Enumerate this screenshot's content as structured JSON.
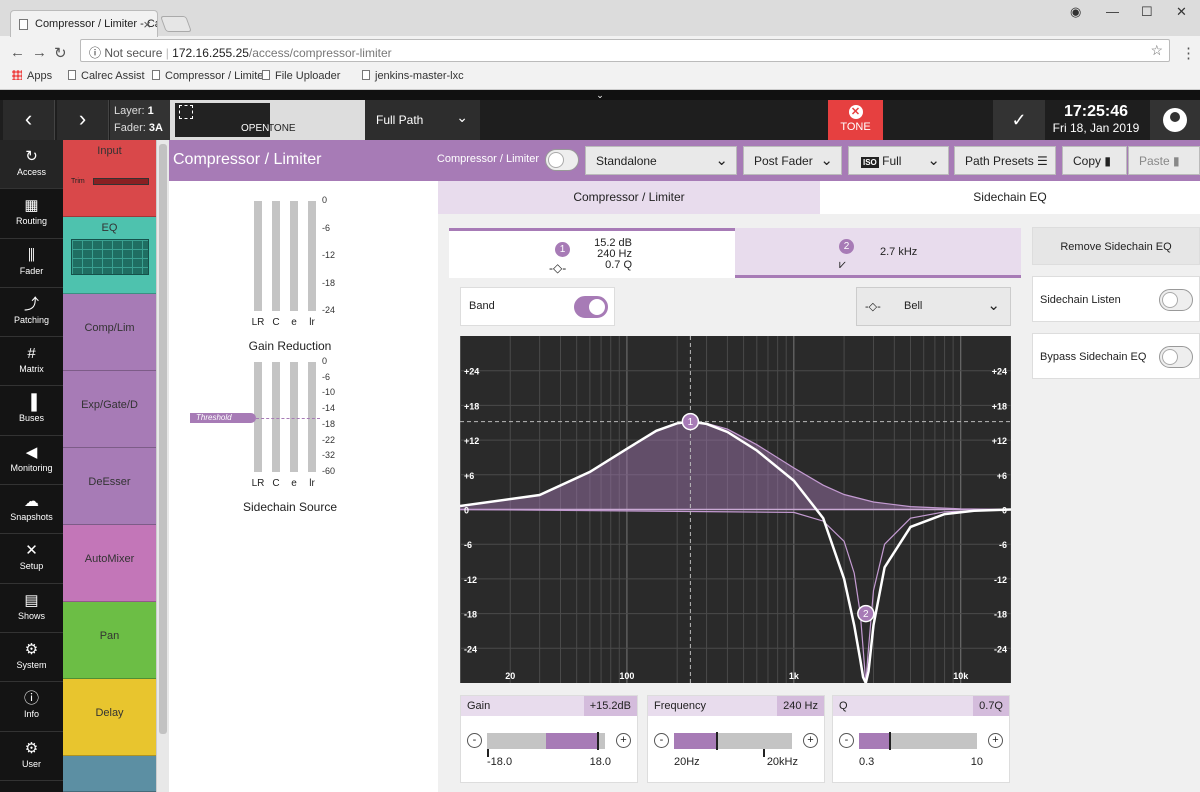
{
  "browser": {
    "tab_title": "Compressor / Limiter - Ca",
    "security": "Not secure",
    "url_host": "172.16.255.25",
    "url_path": "/access/compressor-limiter",
    "bookmarks": [
      "Apps",
      "Calrec Assist",
      "Compressor / Limiter",
      "File Uploader",
      "jenkins-master-lxc"
    ]
  },
  "topbar": {
    "layer_label": "Layer:",
    "layer_value": "1",
    "fader_label": "Fader:",
    "fader_value": "3A",
    "open_label": "OPEN",
    "tone_small": "TONE",
    "path_label": "Full Path",
    "tone_button": "TONE",
    "time": "17:25:46",
    "date": "Fri 18, Jan 2019"
  },
  "sidenav": [
    {
      "label": "Access",
      "icon": "↻"
    },
    {
      "label": "Routing",
      "icon": "▦"
    },
    {
      "label": "Fader",
      "icon": "⫼"
    },
    {
      "label": "Patching",
      "icon": "⤴"
    },
    {
      "label": "Matrix",
      "icon": "#"
    },
    {
      "label": "Buses",
      "icon": "▐"
    },
    {
      "label": "Monitoring",
      "icon": "◀"
    },
    {
      "label": "Snapshots",
      "icon": "☁"
    },
    {
      "label": "Setup",
      "icon": "✕"
    },
    {
      "label": "Shows",
      "icon": "▤"
    },
    {
      "label": "System",
      "icon": "⚙"
    },
    {
      "label": "Info",
      "icon": "ⓘ"
    },
    {
      "label": "User",
      "icon": "⚙"
    }
  ],
  "modules": [
    {
      "label": "Input",
      "color": "#d9484a",
      "sub": "Trim"
    },
    {
      "label": "EQ",
      "color": "#4ec2ae"
    },
    {
      "label": "Comp/Lim",
      "color": "#a77bb6"
    },
    {
      "label": "Exp/Gate/D",
      "color": "#a77bb6"
    },
    {
      "label": "DeEsser",
      "color": "#a77bb6"
    },
    {
      "label": "AutoMixer",
      "color": "#c376b8"
    },
    {
      "label": "Pan",
      "color": "#6cbe45"
    },
    {
      "label": "Delay",
      "color": "#e8c52e"
    },
    {
      "label": "",
      "color": "#5c8fa3"
    }
  ],
  "header": {
    "title": "Compressor / Limiter",
    "toggle_label": "Compressor / Limiter",
    "mode": "Standalone",
    "position": "Post Fader",
    "iso_badge": "ISO",
    "iso_value": "Full",
    "presets": "Path Presets",
    "copy": "Copy",
    "paste": "Paste"
  },
  "meters": {
    "gain_reduction": {
      "caption": "Gain Reduction",
      "scale": [
        "0",
        "-6",
        "-12",
        "-18",
        "-24"
      ],
      "channels": [
        "LR",
        "C",
        "e",
        "lr"
      ]
    },
    "sidechain_source": {
      "caption": "Sidechain Source",
      "scale": [
        "0",
        "-6",
        "-10",
        "-14",
        "-18",
        "-22",
        "-32",
        "-60"
      ],
      "channels": [
        "LR",
        "C",
        "e",
        "lr"
      ],
      "threshold_label": "Threshold"
    }
  },
  "tabs": [
    "Compressor / Limiter",
    "Sidechain EQ"
  ],
  "bands": [
    {
      "num": "1",
      "gain": "15.2 dB",
      "freq": "240 Hz",
      "q": "0.7 Q"
    },
    {
      "num": "2",
      "freq": "2.7 kHz"
    }
  ],
  "band_toggle_label": "Band",
  "filter_type": "Bell",
  "chart_data": {
    "type": "line",
    "x_scale": "log",
    "xlim": [
      10,
      20000
    ],
    "ylim": [
      -30,
      30
    ],
    "x_ticks": [
      {
        "v": 20,
        "l": "20"
      },
      {
        "v": 100,
        "l": "100"
      },
      {
        "v": 1000,
        "l": "1k"
      },
      {
        "v": 10000,
        "l": "10k"
      }
    ],
    "y_ticks": [
      {
        "v": 24,
        "l": "+24"
      },
      {
        "v": 18,
        "l": "+18"
      },
      {
        "v": 12,
        "l": "+12"
      },
      {
        "v": 6,
        "l": "+6"
      },
      {
        "v": 0,
        "l": "0"
      },
      {
        "v": -6,
        "l": "-6"
      },
      {
        "v": -12,
        "l": "-12"
      },
      {
        "v": -18,
        "l": "-18"
      },
      {
        "v": -24,
        "l": "-24"
      }
    ],
    "series": [
      {
        "x": [
          10,
          30,
          60,
          100,
          150,
          200,
          240,
          300,
          400,
          600,
          1000,
          1500,
          2000,
          2300,
          2500,
          2600,
          2700,
          2800,
          3000,
          3500,
          5000,
          8000,
          12000,
          20000
        ],
        "y": [
          0.6,
          2.5,
          6.5,
          10.5,
          13.6,
          14.9,
          15.2,
          14.8,
          13.4,
          10.2,
          5.0,
          -1.5,
          -12.0,
          -20.0,
          -26.0,
          -29.0,
          -30.0,
          -28.0,
          -20.0,
          -10.0,
          -3.0,
          -0.8,
          -0.2,
          0
        ]
      },
      {
        "x": [
          10,
          30,
          60,
          100,
          150,
          200,
          240,
          300,
          400,
          600,
          1000,
          1500,
          2000,
          3000,
          5000,
          10000,
          20000
        ],
        "y": [
          0.6,
          2.5,
          6.5,
          10.5,
          13.6,
          14.9,
          15.2,
          14.9,
          13.9,
          11.2,
          7.2,
          4.2,
          2.6,
          1.3,
          0.5,
          0.1,
          0
        ]
      },
      {
        "x": [
          10,
          1000,
          1500,
          2000,
          2300,
          2500,
          2600,
          2700,
          2800,
          3000,
          3500,
          5000,
          8000,
          20000
        ],
        "y": [
          0,
          -0.5,
          -2.0,
          -5.5,
          -11.0,
          -18.0,
          -24.0,
          -30.0,
          -24.0,
          -14.0,
          -6.0,
          -1.5,
          -0.4,
          0
        ]
      }
    ],
    "points": [
      {
        "label": "1",
        "x": 240,
        "y": 15.2
      },
      {
        "label": "2",
        "x": 2700,
        "y": -18
      }
    ],
    "grid": true
  },
  "controls": {
    "gain": {
      "label": "Gain",
      "value": "+15.2dB",
      "min": "-18.0",
      "max": "18.0",
      "fill_from": 0.5,
      "fill_to": 0.93
    },
    "frequency": {
      "label": "Frequency",
      "value": "240 Hz",
      "min": "20Hz",
      "max": "20kHz",
      "fill_from": 0,
      "fill_to": 0.36,
      "marker2": 0.75
    },
    "q": {
      "label": "Q",
      "value": "0.7Q",
      "min": "0.3",
      "max": "10",
      "fill_from": 0,
      "fill_to": 0.25
    }
  },
  "sidepanel": {
    "remove": "Remove Sidechain EQ",
    "listen": "Sidechain Listen",
    "bypass": "Bypass Sidechain EQ"
  },
  "colors": {
    "accent": "#a77bb6",
    "tone": "#e64040"
  }
}
